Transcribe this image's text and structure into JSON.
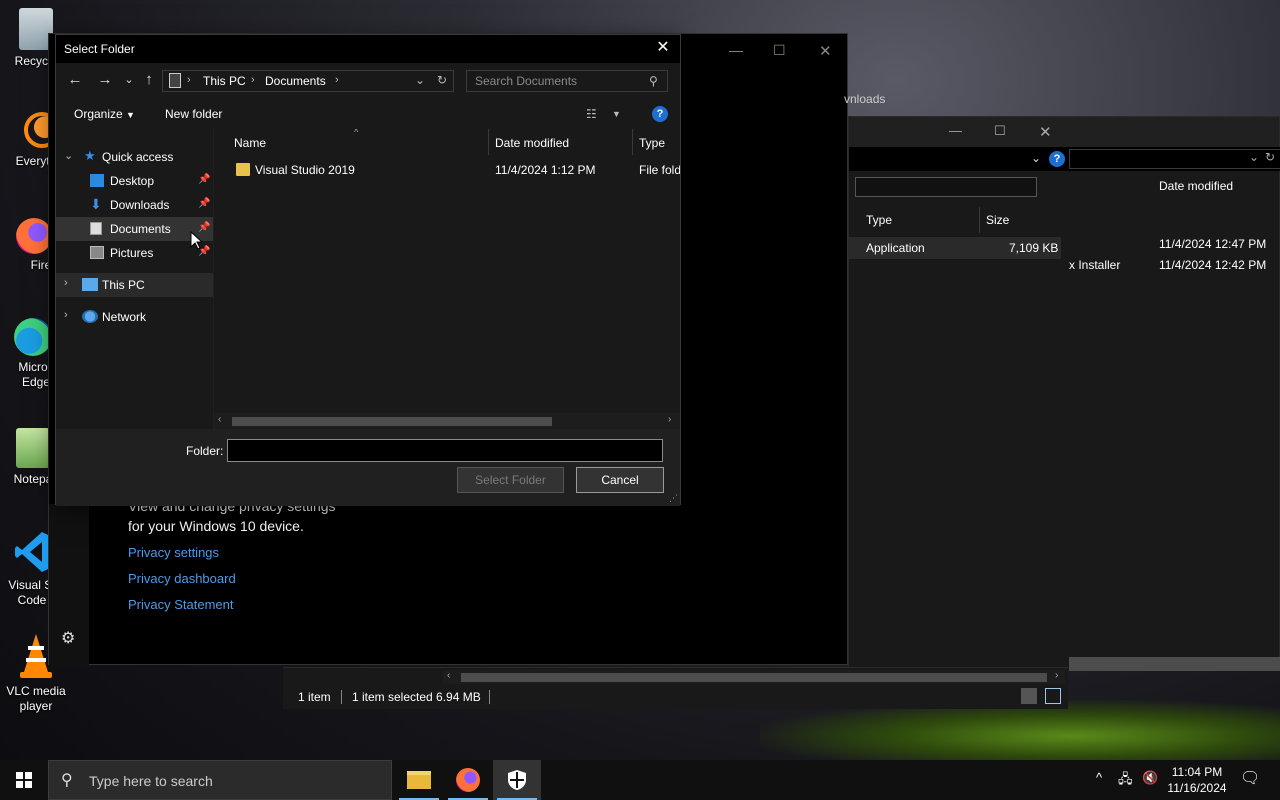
{
  "desktop": {
    "icons": [
      {
        "label": "Recycle"
      },
      {
        "label": "Everyth"
      },
      {
        "label": "Firefo"
      },
      {
        "label": "Micros Edge"
      },
      {
        "label": "Notepac"
      },
      {
        "label": "Visual St Code"
      },
      {
        "label": "VLC media player"
      }
    ]
  },
  "bg_explorer": {
    "breadcrumb_tail": "vnloads",
    "columns": [
      "Type",
      "Size"
    ],
    "row": {
      "type": "Application",
      "size": "7,109 KB"
    },
    "right_window": {
      "date_header": "Date modified",
      "rows": [
        {
          "name": "",
          "date": "11/4/2024 12:47 PM"
        },
        {
          "name": "x Installer",
          "date": "11/4/2024 12:42 PM"
        }
      ]
    },
    "status": {
      "items": "1 item",
      "selected": "1 item selected  6.94 MB"
    }
  },
  "settings": {
    "desc_line1": "View and change privacy settings",
    "desc_line2": "for your Windows 10 device.",
    "links": [
      "Privacy settings",
      "Privacy dashboard",
      "Privacy Statement"
    ]
  },
  "dialog": {
    "title": "Select Folder",
    "address": {
      "segments": [
        "This PC",
        "Documents"
      ]
    },
    "search_placeholder": "Search Documents",
    "toolbar": {
      "organize": "Organize",
      "new_folder": "New folder"
    },
    "nav": {
      "quick_access": "Quick access",
      "items": [
        "Desktop",
        "Downloads",
        "Documents",
        "Pictures"
      ],
      "this_pc": "This PC",
      "network": "Network"
    },
    "columns": {
      "name": "Name",
      "date": "Date modified",
      "type": "Type"
    },
    "files": [
      {
        "name": "Visual Studio 2019",
        "date": "11/4/2024 1:12 PM",
        "type": "File fold"
      }
    ],
    "folder_label": "Folder:",
    "folder_value": "",
    "select_button": "Select Folder",
    "cancel_button": "Cancel"
  },
  "taskbar": {
    "search_placeholder": "Type here to search",
    "time": "11:04 PM",
    "date": "11/16/2024"
  }
}
